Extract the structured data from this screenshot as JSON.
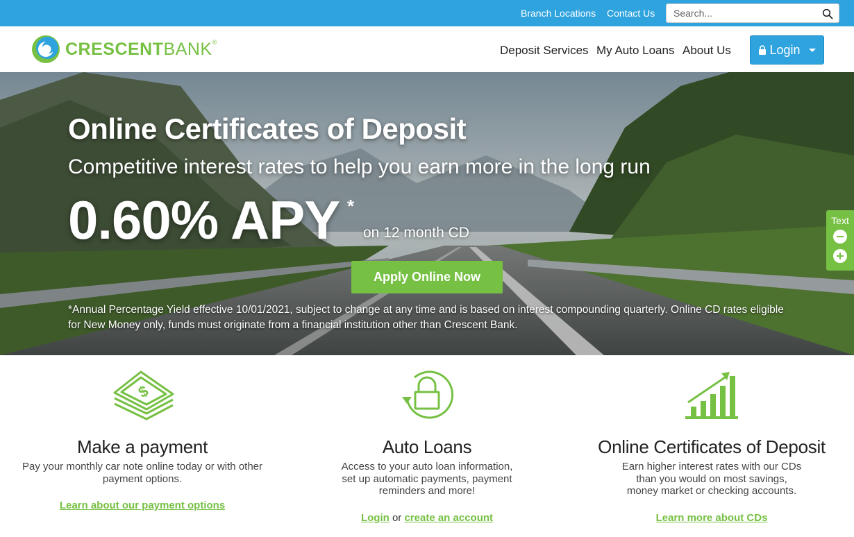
{
  "topbar": {
    "branch_locations": "Branch Locations",
    "contact_us": "Contact Us",
    "search_placeholder": "Search..."
  },
  "brand": {
    "name_bold": "CRESCENT",
    "name_thin": "BANK",
    "registered": "®",
    "green": "#76c043",
    "blue": "#2ea3de"
  },
  "nav": {
    "items": [
      {
        "label": "Deposit Services"
      },
      {
        "label": "My Auto Loans"
      },
      {
        "label": "About Us"
      }
    ],
    "login_label": "Login"
  },
  "hero": {
    "title": "Online Certificates of Deposit",
    "subtitle": "Competitive interest rates to help you earn more in the long run",
    "rate": "0.60% APY",
    "rate_marker": "*",
    "term": "on 12 month CD",
    "cta_label": "Apply Online Now",
    "disclaimer": "*Annual Percentage Yield effective 10/01/2021, subject to change at any time and is based on interest compounding quarterly. Online CD rates eligible for New Money only, funds must originate from a financial institution other than Crescent Bank."
  },
  "text_widget": {
    "label": "Text"
  },
  "features": [
    {
      "icon": "money-stack-icon",
      "title": "Make a payment",
      "description": "Pay your monthly car note online today or with other payment options.",
      "link_label": "Learn about our payment options"
    },
    {
      "icon": "lock-refresh-icon",
      "title": "Auto Loans",
      "description": "Access to your auto loan information, set up automatic payments, payment reminders and more!",
      "link_login": "Login",
      "link_joiner": "or",
      "link_create": "create an account"
    },
    {
      "icon": "growth-chart-icon",
      "title": "Online Certificates of Deposit",
      "description": "Earn higher interest rates with our CDs than you would on most savings, money market or checking accounts.",
      "link_label": "Learn more about CDs"
    }
  ]
}
